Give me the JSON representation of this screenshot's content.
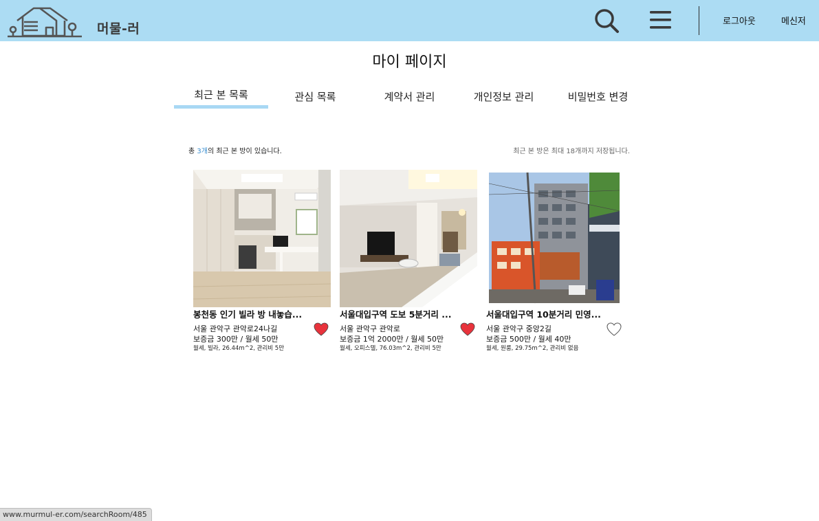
{
  "header": {
    "logo_icon": "house-logo-icon",
    "brand": "머물-러",
    "search_icon": "search-icon",
    "menu_icon": "hamburger-menu-icon",
    "logout_label": "로그아웃",
    "messenger_label": "메신저",
    "background_color": "#acdcf3"
  },
  "page": {
    "title": "마이 페이지"
  },
  "tabs": [
    {
      "label": "최근 본 목록",
      "active": true
    },
    {
      "label": "관심 목록",
      "active": false
    },
    {
      "label": "계약서 관리",
      "active": false
    },
    {
      "label": "개인정보 관리",
      "active": false
    },
    {
      "label": "비밀번호 변경",
      "active": false
    }
  ],
  "summary": {
    "prefix": "총 ",
    "count": "3개",
    "suffix": "의 최근 본 방이 있습니다.",
    "limit_note": "최근 본 방은 최대 18개까지 저장됩니다."
  },
  "rooms": [
    {
      "title": "봉천동 인기 빌라 방 내놓습...",
      "address": "서울 관악구 관악로24나길",
      "price": "보증금 300만 / 월세 50만",
      "detail": "월세, 빌라, 26.44m^2, 관리비 5만",
      "liked": true
    },
    {
      "title": "서울대입구역 도보 5분거리 ...",
      "address": "서울 관악구 관악로",
      "price": "보증금 1억 2000만 / 월세 50만",
      "detail": "월세, 오피스텔, 76.03m^2, 관리비 5만",
      "liked": true
    },
    {
      "title": "서울대입구역 10분거리 민영...",
      "address": "서울 관악구 중앙2길",
      "price": "보증금 500만 / 월세 40만",
      "detail": "월세, 원룸, 29.75m^2, 관리비 없음",
      "liked": false
    }
  ],
  "status_bar": {
    "url": "www.murmul-er.com/searchRoom/485"
  },
  "colors": {
    "accent": "#a8d8f4",
    "count_highlight": "#3b8fd0",
    "heart_filled": "#e8333c"
  }
}
